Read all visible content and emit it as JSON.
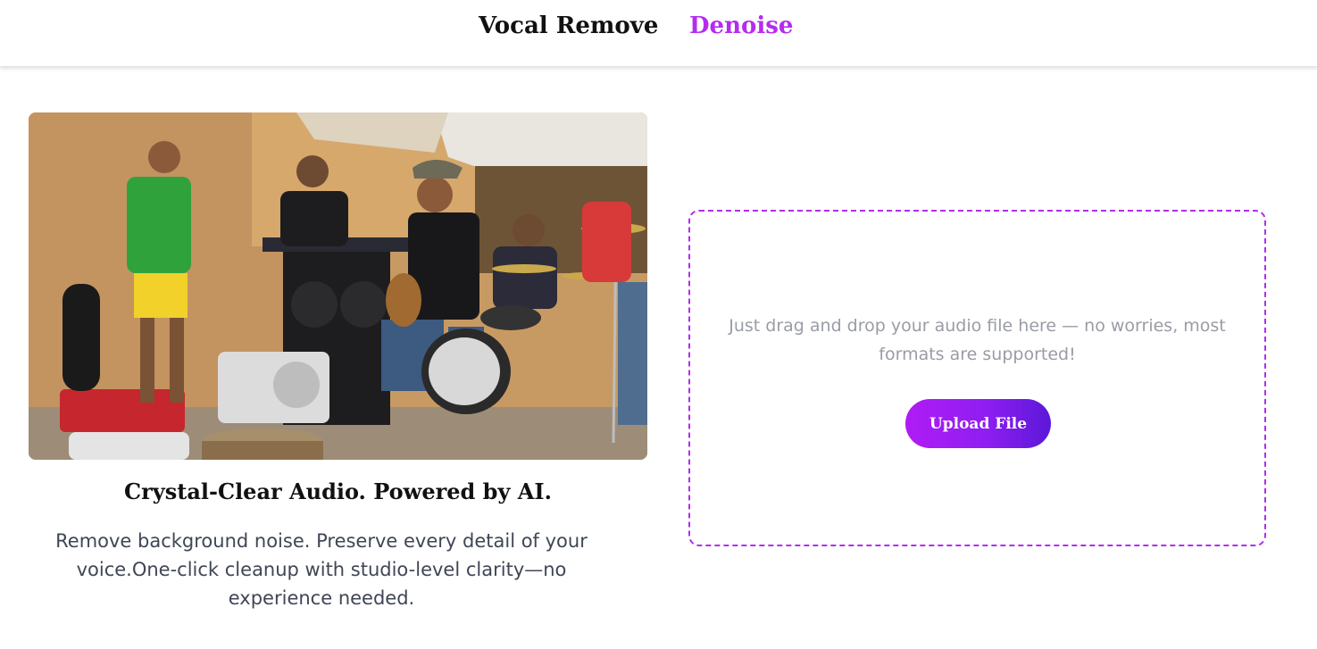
{
  "nav": {
    "items": [
      {
        "label": "Vocal Remove",
        "active": false
      },
      {
        "label": "Denoise",
        "active": true
      }
    ],
    "active_color": "#b52cf0"
  },
  "hero": {
    "image_alt_icon": "band-photo",
    "headline": "Crystal-Clear Audio. Powered by AI.",
    "description": "Remove background noise. Preserve every detail of your voice.One-click cleanup with studio-level clarity—no experience needed."
  },
  "upload": {
    "hint": "Just drag and drop your audio file here — no worries, most formats are supported!",
    "button_label": "Upload File",
    "accent_color": "#b12cf0"
  }
}
